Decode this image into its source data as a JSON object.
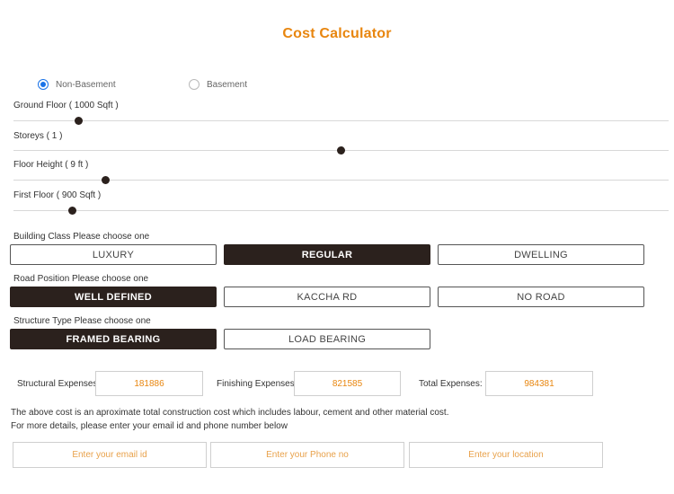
{
  "title": "Cost Calculator",
  "basement_options": [
    {
      "label": "Non-Basement",
      "checked": true
    },
    {
      "label": "Basement",
      "checked": false
    }
  ],
  "sliders": [
    {
      "label": "Ground Floor ( 1000 Sqft )",
      "level_percent": 10
    },
    {
      "label": "Storeys ( 1 )",
      "level_percent": 50
    },
    {
      "label": "Floor Height ( 9 ft )",
      "level_percent": 14
    },
    {
      "label": "First Floor ( 900 Sqft )",
      "level_percent": 9
    }
  ],
  "building_class": {
    "label": "Building Class Please choose one",
    "options": [
      "LUXURY",
      "REGULAR",
      "DWELLING"
    ],
    "selected": "REGULAR"
  },
  "road_position": {
    "label": "Road Position Please choose one",
    "options": [
      "WELL DEFINED",
      "KACCHA RD",
      "NO ROAD"
    ],
    "selected": "WELL DEFINED"
  },
  "structure_type": {
    "label": "Structure Type Please choose one",
    "options": [
      "FRAMED BEARING",
      "LOAD BEARING"
    ],
    "selected": "FRAMED BEARING"
  },
  "expenses": {
    "structural_label": "Structural Expenses:",
    "structural_value": "181886",
    "finishing_label": "Finishing Expenses:",
    "finishing_value": "821585",
    "total_label": "Total Expenses:",
    "total_value": "984381"
  },
  "notes": {
    "line1": "The above cost is an aproximate total construction cost which includes labour, cement and other material cost.",
    "line2": "For more details, please enter your email id and phone number below"
  },
  "contact": {
    "email_placeholder": "Enter your email id",
    "phone_placeholder": "Enter your Phone no",
    "location_placeholder": "Enter your location"
  },
  "colors": {
    "accent": "#e8860f",
    "selected_bg": "#2b211d",
    "radio_active": "#1a73e8"
  }
}
